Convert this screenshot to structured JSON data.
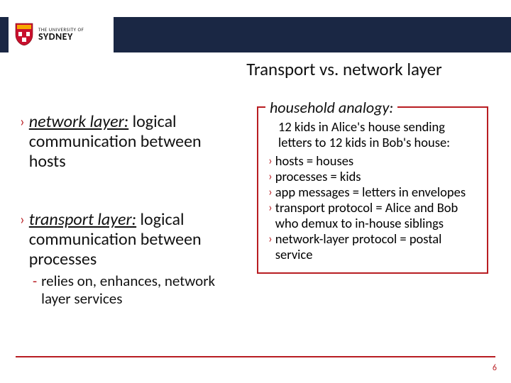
{
  "logo": {
    "small": "THE UNIVERSITY OF",
    "big": "SYDNEY",
    "crest_fill": "#c8102e",
    "crest_accent": "#f7a800"
  },
  "title": "Transport vs. network layer",
  "left": {
    "b1": {
      "term": "network layer:",
      "rest": " logical communication between hosts"
    },
    "b2": {
      "term": "transport layer:",
      "rest": " logical communication between processes"
    },
    "b2sub": "relies on, enhances, network layer services"
  },
  "analogy": {
    "legend": "household analogy:",
    "intro": "12 kids in Alice's house sending letters to 12 kids in Bob's house:",
    "items": [
      "hosts = houses",
      "processes = kids",
      "app messages = letters in envelopes",
      "transport protocol = Alice and Bob who demux to in-house siblings",
      "network-layer protocol = postal service"
    ]
  },
  "page": "6",
  "glyphs": {
    "chev": "›",
    "dash": "-"
  }
}
